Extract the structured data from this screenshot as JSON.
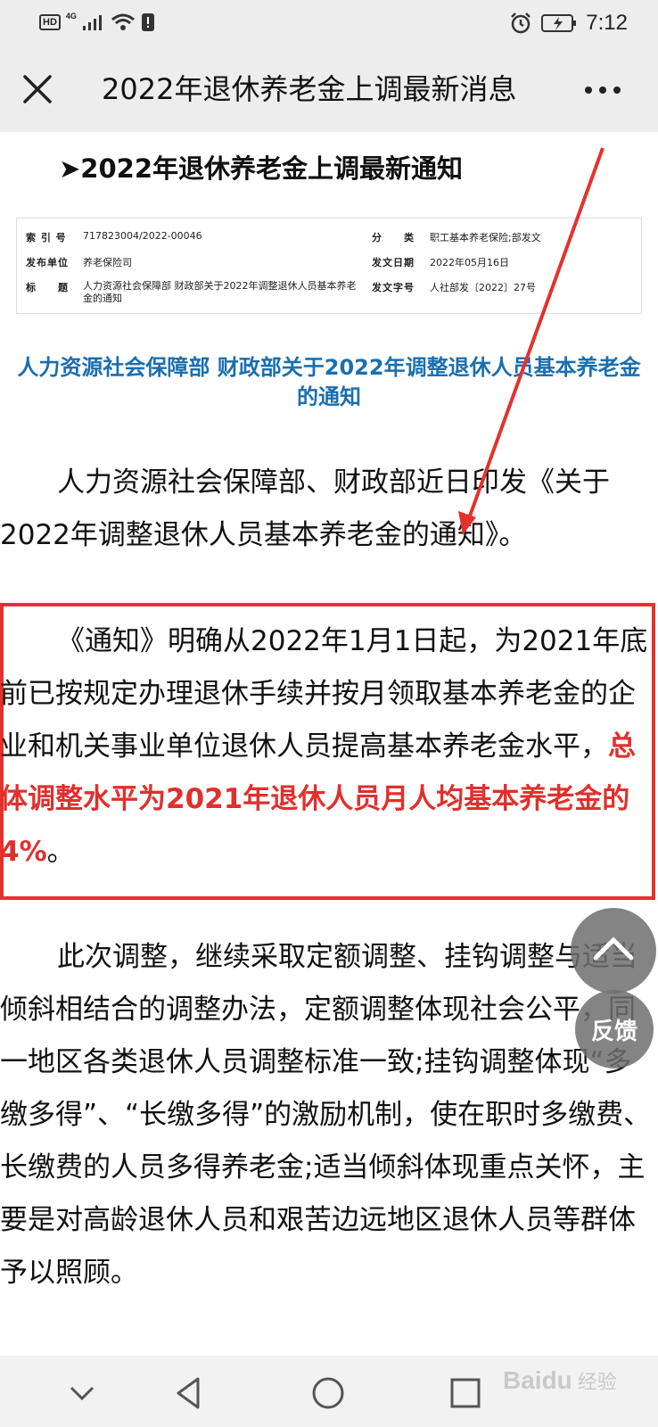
{
  "status_bar": {
    "hd_label": "HD",
    "network_label": "4G",
    "time": "7:12"
  },
  "header": {
    "title": "2022年退休养老金上调最新消息"
  },
  "article": {
    "section_heading": "➤2022年退休养老金上调最新通知",
    "meta": {
      "index_label": "索 引 号",
      "index_value": "717823004/2022-00046",
      "category_label": "分　　类",
      "category_value": "职工基本养老保险;部发文",
      "publisher_label": "发布单位",
      "publisher_value": "养老保险司",
      "date_label": "发文日期",
      "date_value": "2022年05月16日",
      "title_label": "标　　题",
      "title_value": "人力资源社会保障部 财政部关于2022年调整退休人员基本养老金的通知",
      "doc_no_label": "发文字号",
      "doc_no_value": "人社部发〔2022〕27号"
    },
    "doc_title": "人力资源社会保障部 财政部关于2022年调整退休人员基本养老金的通知",
    "para1": "人力资源社会保障部、财政部近日印发《关于2022年调整退休人员基本养老金的通知》。",
    "para2_normal": "《通知》明确从2022年1月1日起，为2021年底前已按规定办理退休手续并按月领取基本养老金的企业和机关事业单位退休人员提高基本养老金水平，",
    "para2_highlight": "总体调整水平为2021年退休人员月人均基本养老金的4%",
    "para2_end": "。",
    "para3": "此次调整，继续采取定额调整、挂钩调整与适当倾斜相结合的调整办法，定额调整体现社会公平，同一地区各类退休人员调整标准一致;挂钩调整体现“多缴多得”、“长缴多得”的激励机制，使在职时多缴费、长缴费的人员多得养老金;适当倾斜体现重点关怀，主要是对高龄退休人员和艰苦边远地区退休人员等群体予以照顾。"
  },
  "floating": {
    "feedback_label": "反馈"
  },
  "watermark": {
    "brand": "Baidu",
    "suffix": "经验"
  },
  "colors": {
    "accent_red": "#e5312e",
    "doc_title_blue": "#1a6fb0",
    "bar_gray": "#ededed"
  }
}
